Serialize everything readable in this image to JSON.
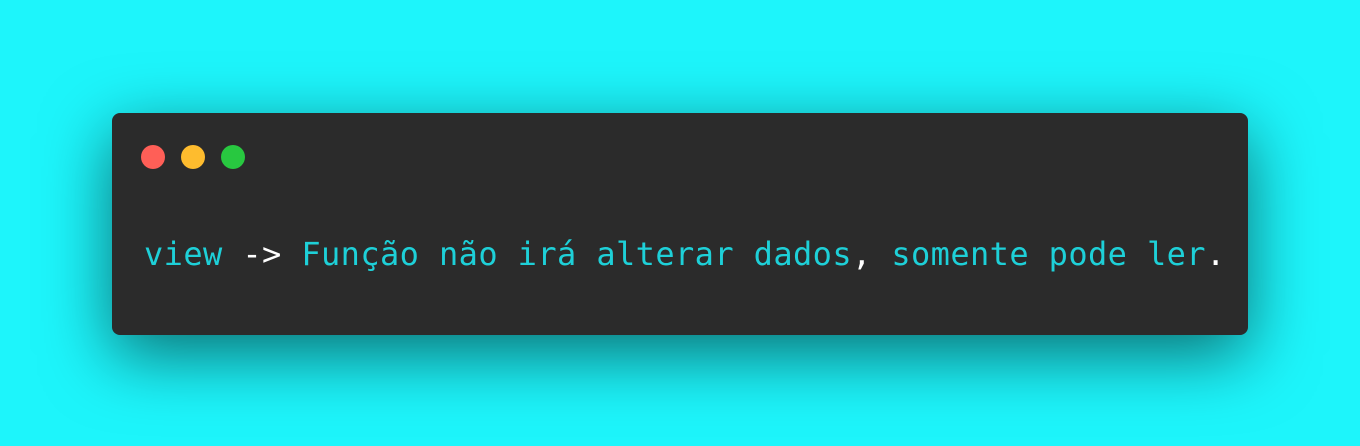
{
  "theme": {
    "background": "#1df5fb",
    "window_bg": "#2b2b2b",
    "token_accent": "#1ed0d8",
    "token_plain": "#ffffff"
  },
  "window_controls": [
    {
      "name": "close",
      "color": "#ff5f57"
    },
    {
      "name": "minimize",
      "color": "#febc2e"
    },
    {
      "name": "zoom",
      "color": "#28c840"
    }
  ],
  "code": {
    "keyword": "view",
    "arrow": " -> ",
    "text_1": "Função não irá alterar dados",
    "comma": ", ",
    "text_2": "somente pode ler",
    "period": "."
  }
}
